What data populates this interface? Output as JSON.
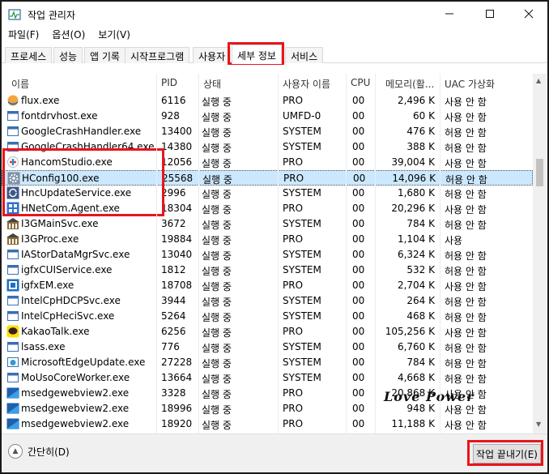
{
  "window": {
    "title": "작업 관리자",
    "minimize": "—",
    "maximize": "☐",
    "close": "✕"
  },
  "menu": [
    "파일(F)",
    "옵션(O)",
    "보기(V)"
  ],
  "tabs": [
    "프로세스",
    "성능",
    "앱 기록",
    "시작프로그램",
    "사용자",
    "세부 정보",
    "서비스"
  ],
  "active_tab": "세부 정보",
  "columns": [
    "이름",
    "PID",
    "상태",
    "사용자 이름",
    "CPU",
    "메모리(활...",
    "UAC 가상화"
  ],
  "rows": [
    {
      "name": "flux.exe",
      "pid": "6116",
      "status": "실행 중",
      "user": "PRO",
      "cpu": "00",
      "mem": "2,496 K",
      "uac": "사용 안 함",
      "icon": "flux-icon"
    },
    {
      "name": "fontdrvhost.exe",
      "pid": "928",
      "status": "실행 중",
      "user": "UMFD-0",
      "cpu": "00",
      "mem": "60 K",
      "uac": "사용 안 함",
      "icon": "window-icon"
    },
    {
      "name": "GoogleCrashHandler.exe",
      "pid": "13400",
      "status": "실행 중",
      "user": "SYSTEM",
      "cpu": "00",
      "mem": "476 K",
      "uac": "허용 안 함",
      "icon": "window-icon"
    },
    {
      "name": "GoogleCrashHandler64.exe",
      "pid": "14380",
      "status": "실행 중",
      "user": "SYSTEM",
      "cpu": "00",
      "mem": "388 K",
      "uac": "허용 안 함",
      "icon": "window-icon"
    },
    {
      "name": "HancomStudio.exe",
      "pid": "12056",
      "status": "실행 중",
      "user": "PRO",
      "cpu": "00",
      "mem": "39,004 K",
      "uac": "사용 안 함",
      "icon": "hancom-studio-icon"
    },
    {
      "name": "HConfig100.exe",
      "pid": "25568",
      "status": "실행 중",
      "user": "PRO",
      "cpu": "00",
      "mem": "14,096 K",
      "uac": "허용 안 함",
      "icon": "gear-icon",
      "selected": true
    },
    {
      "name": "HncUpdateService.exe",
      "pid": "2996",
      "status": "실행 중",
      "user": "SYSTEM",
      "cpu": "00",
      "mem": "1,680 K",
      "uac": "허용 안 함",
      "icon": "update-icon"
    },
    {
      "name": "HNetCom.Agent.exe",
      "pid": "18304",
      "status": "실행 중",
      "user": "PRO",
      "cpu": "00",
      "mem": "20,296 K",
      "uac": "사용 안 함",
      "icon": "grid-icon"
    },
    {
      "name": "I3GMainSvc.exe",
      "pid": "3672",
      "status": "실행 중",
      "user": "SYSTEM",
      "cpu": "00",
      "mem": "784 K",
      "uac": "허용 안 함",
      "icon": "building-icon"
    },
    {
      "name": "I3GProc.exe",
      "pid": "19884",
      "status": "실행 중",
      "user": "PRO",
      "cpu": "00",
      "mem": "1,104 K",
      "uac": "사용",
      "icon": "building-icon"
    },
    {
      "name": "IAStorDataMgrSvc.exe",
      "pid": "13040",
      "status": "실행 중",
      "user": "SYSTEM",
      "cpu": "00",
      "mem": "6,324 K",
      "uac": "허용 안 함",
      "icon": "window-icon"
    },
    {
      "name": "igfxCUIService.exe",
      "pid": "1812",
      "status": "실행 중",
      "user": "SYSTEM",
      "cpu": "00",
      "mem": "532 K",
      "uac": "허용 안 함",
      "icon": "window-icon"
    },
    {
      "name": "igfxEM.exe",
      "pid": "18708",
      "status": "실행 중",
      "user": "PRO",
      "cpu": "00",
      "mem": "2,704 K",
      "uac": "사용 안 함",
      "icon": "intel-icon"
    },
    {
      "name": "IntelCpHDCPSvc.exe",
      "pid": "3944",
      "status": "실행 중",
      "user": "SYSTEM",
      "cpu": "00",
      "mem": "264 K",
      "uac": "허용 안 함",
      "icon": "window-icon"
    },
    {
      "name": "IntelCpHeciSvc.exe",
      "pid": "5264",
      "status": "실행 중",
      "user": "SYSTEM",
      "cpu": "00",
      "mem": "468 K",
      "uac": "허용 안 함",
      "icon": "window-icon"
    },
    {
      "name": "KakaoTalk.exe",
      "pid": "6256",
      "status": "실행 중",
      "user": "PRO",
      "cpu": "00",
      "mem": "105,256 K",
      "uac": "사용 안 함",
      "icon": "kakaotalk-icon"
    },
    {
      "name": "lsass.exe",
      "pid": "776",
      "status": "실행 중",
      "user": "SYSTEM",
      "cpu": "00",
      "mem": "6,760 K",
      "uac": "허용 안 함",
      "icon": "window-icon"
    },
    {
      "name": "MicrosoftEdgeUpdate.exe",
      "pid": "27228",
      "status": "실행 중",
      "user": "SYSTEM",
      "cpu": "00",
      "mem": "784 K",
      "uac": "허용 안 함",
      "icon": "edge-update-icon"
    },
    {
      "name": "MoUsoCoreWorker.exe",
      "pid": "13664",
      "status": "실행 중",
      "user": "SYSTEM",
      "cpu": "00",
      "mem": "4,668 K",
      "uac": "허용 안 함",
      "icon": "window-icon"
    },
    {
      "name": "msedgewebview2.exe",
      "pid": "3328",
      "status": "실행 중",
      "user": "PRO",
      "cpu": "00",
      "mem": "20,868 K",
      "uac": "사용 안 함",
      "icon": "webview-icon"
    },
    {
      "name": "msedgewebview2.exe",
      "pid": "18996",
      "status": "실행 중",
      "user": "PRO",
      "cpu": "00",
      "mem": "948 K",
      "uac": "사용 안 함",
      "icon": "webview-icon"
    },
    {
      "name": "msedgewebview2.exe",
      "pid": "18920",
      "status": "실행 중",
      "user": "PRO",
      "cpu": "00",
      "mem": "11,188 K",
      "uac": "사용 안 함",
      "icon": "webview-icon"
    }
  ],
  "footer": {
    "fewer_details": "간단히(D)",
    "end_task": "작업 끝내기(E)"
  },
  "watermark": "Love Power",
  "colors": {
    "selection": "#cce8ff",
    "annotation_red": "#e8151c"
  }
}
